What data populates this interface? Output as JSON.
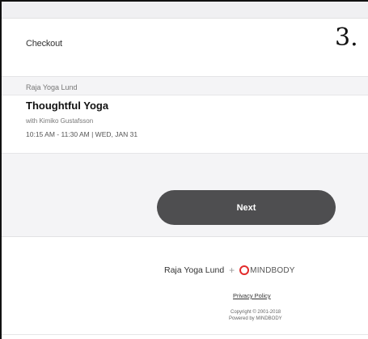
{
  "header": {
    "title": "Checkout",
    "step_number": "3."
  },
  "class_info": {
    "studio": "Raja Yoga Lund",
    "class_name": "Thoughtful Yoga",
    "instructor": "with Kimiko Gustafsson",
    "schedule": "10:15 AM - 11:30 AM | WED, JAN 31"
  },
  "actions": {
    "next_label": "Next"
  },
  "footer": {
    "studio_brand": "Raja Yoga Lund",
    "plus": "+",
    "partner_brand": "MINDBODY",
    "privacy_label": "Privacy Policy",
    "copyright": "Copyright © 2001-2018",
    "powered_by": "Powered by MINDBODY"
  },
  "colors": {
    "button_bg": "#4e4e50",
    "page_bg": "#f4f4f6",
    "mindbody_red": "#e32b2b"
  }
}
